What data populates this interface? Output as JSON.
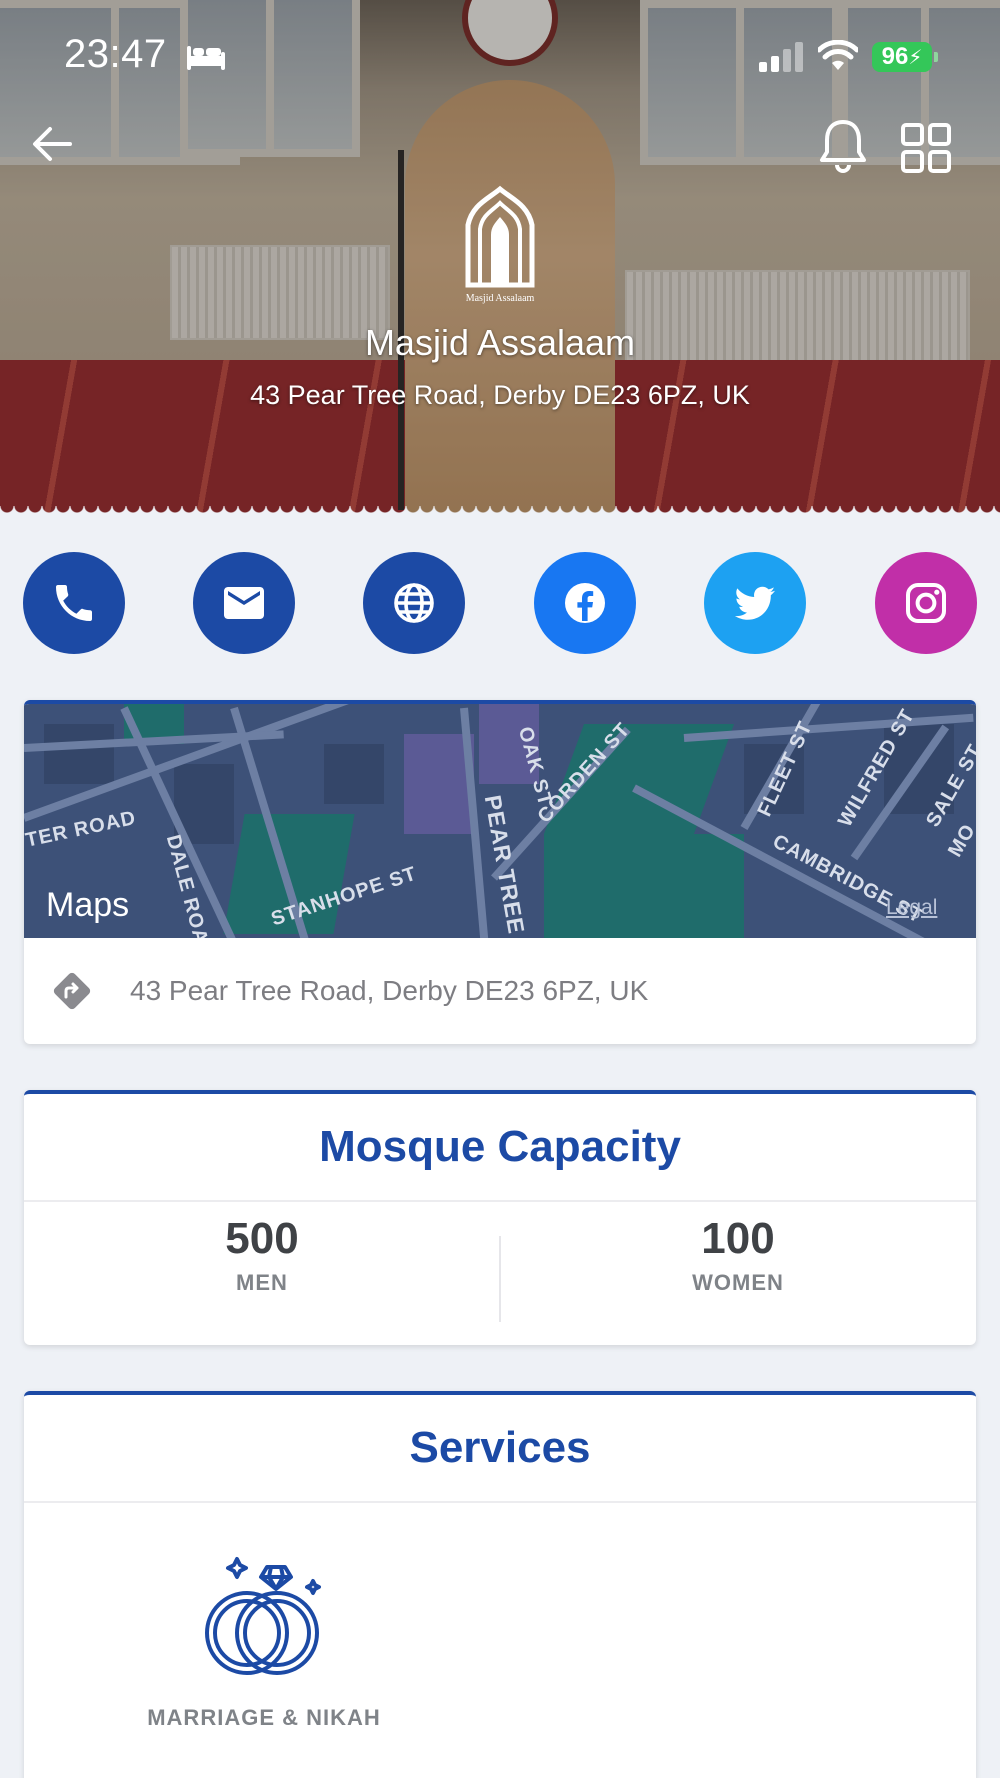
{
  "status_bar": {
    "time": "23:47",
    "battery": "96"
  },
  "mosque": {
    "name": "Masjid Assalaam",
    "address": "43 Pear Tree Road, Derby DE23 6PZ, UK",
    "logo_text": "Masjid Assalaam"
  },
  "contact_buttons": [
    {
      "name": "phone",
      "icon": "phone-icon",
      "color": "#1c4aa5"
    },
    {
      "name": "email",
      "icon": "mail-icon",
      "color": "#1c4aa5"
    },
    {
      "name": "website",
      "icon": "globe-icon",
      "color": "#1c4aa5"
    },
    {
      "name": "facebook",
      "icon": "facebook-icon",
      "color": "#1877f2"
    },
    {
      "name": "twitter",
      "icon": "twitter-icon",
      "color": "#1da1f2"
    },
    {
      "name": "instagram",
      "icon": "instagram-icon",
      "color": "#c12fa8"
    }
  ],
  "map": {
    "provider_label": "Maps",
    "legal_label": "Legal",
    "street_labels": [
      "TER ROAD",
      "DALE ROAD",
      "STANHOPE ST",
      "PEAR TREE RO",
      "OAK ST",
      "CORDEN ST",
      "FLEET ST",
      "WILFRED ST",
      "SALE ST",
      "CAMBRIDGE ST",
      "MO"
    ],
    "directions_address": "43 Pear Tree Road, Derby DE23 6PZ, UK"
  },
  "capacity": {
    "title": "Mosque Capacity",
    "men_count": "500",
    "men_label": "MEN",
    "women_count": "100",
    "women_label": "WOMEN"
  },
  "services": {
    "title": "Services",
    "items": [
      {
        "label": "MARRIAGE & NIKAH",
        "icon": "rings-icon"
      }
    ]
  },
  "colors": {
    "primary": "#1c4aa5",
    "background": "#eef1f6"
  }
}
